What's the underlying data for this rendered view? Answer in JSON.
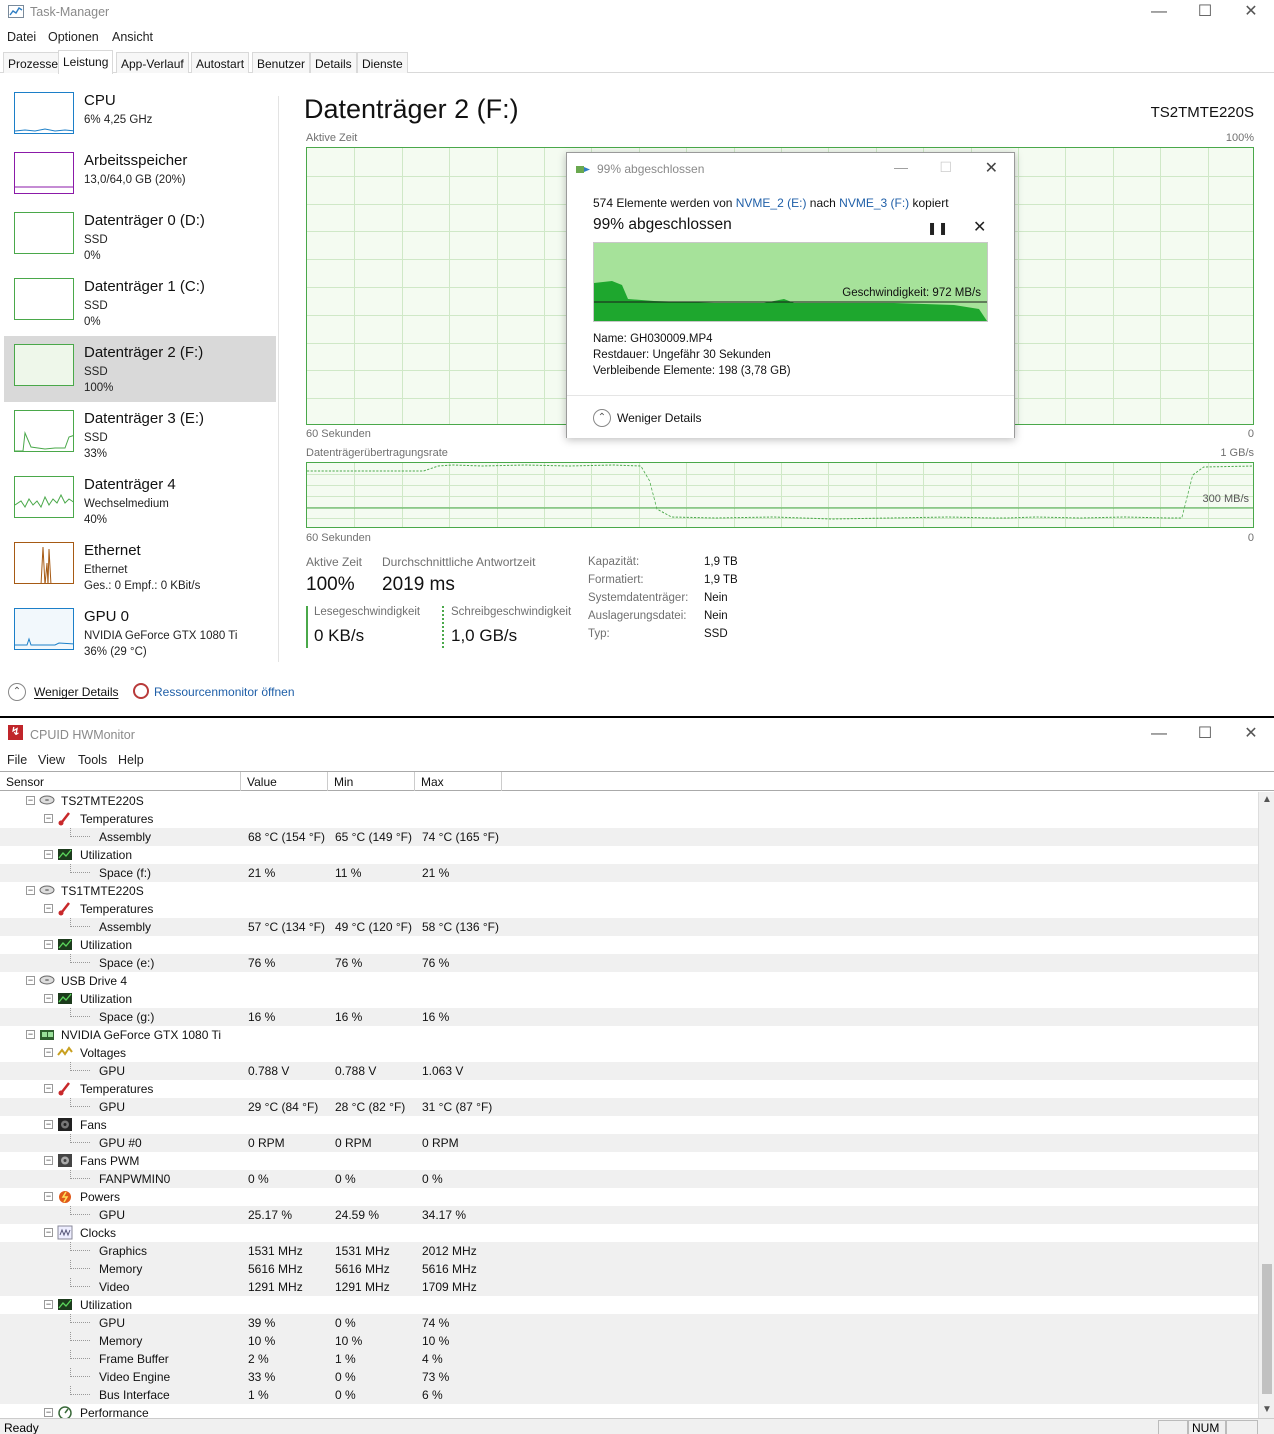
{
  "task_manager": {
    "title": "Task-Manager",
    "menu": [
      "Datei",
      "Optionen",
      "Ansicht"
    ],
    "tabs": [
      "Prozesse",
      "Leistung",
      "App-Verlauf",
      "Autostart",
      "Benutzer",
      "Details",
      "Dienste"
    ],
    "active_tab": "Leistung",
    "sidebar": [
      {
        "name": "CPU",
        "l1": "6% 4,25 GHz",
        "l2": "",
        "color": "#1c7fc8"
      },
      {
        "name": "Arbeitsspeicher",
        "l1": "13,0/64,0 GB (20%)",
        "l2": "",
        "color": "#8b1aa8"
      },
      {
        "name": "Datenträger 0 (D:)",
        "l1": "SSD",
        "l2": "0%",
        "color": "#4aa84a"
      },
      {
        "name": "Datenträger 1 (C:)",
        "l1": "SSD",
        "l2": "0%",
        "color": "#4aa84a"
      },
      {
        "name": "Datenträger 2 (F:)",
        "l1": "SSD",
        "l2": "100%",
        "color": "#4aa84a"
      },
      {
        "name": "Datenträger 3 (E:)",
        "l1": "SSD",
        "l2": "33%",
        "color": "#4aa84a"
      },
      {
        "name": "Datenträger 4",
        "l1": "Wechselmedium",
        "l2": "40%",
        "color": "#4aa84a"
      },
      {
        "name": "Ethernet",
        "l1": "Ethernet",
        "l2": "Ges.: 0 Empf.: 0 KBit/s",
        "color": "#a65a14"
      },
      {
        "name": "GPU 0",
        "l1": "NVIDIA GeForce GTX 1080 Ti",
        "l2": "36% (29 °C)",
        "color": "#1c7fc8"
      }
    ],
    "main": {
      "title": "Datenträger 2 (F:)",
      "model": "TS2TMTE220S",
      "graph1_label": "Aktive Zeit",
      "graph1_max": "100%",
      "graph1_time": "60 Sekunden",
      "graph1_min": "0",
      "graph2_label": "Datenträgerübertragungsrate",
      "graph2_max": "1 GB/s",
      "graph2_mid": "300 MB/s",
      "graph2_time": "60 Sekunden",
      "graph2_min": "0",
      "active_time_label": "Aktive Zeit",
      "active_time": "100%",
      "response_label": "Durchschnittliche Antwortzeit",
      "response": "2019 ms",
      "read_label": "Lesegeschwindigkeit",
      "read": "0 KB/s",
      "write_label": "Schreibgeschwindigkeit",
      "write": "1,0 GB/s",
      "props": [
        {
          "k": "Kapazität:",
          "v": "1,9 TB"
        },
        {
          "k": "Formatiert:",
          "v": "1,9 TB"
        },
        {
          "k": "Systemdatenträger:",
          "v": "Nein"
        },
        {
          "k": "Auslagerungsdatei:",
          "v": "Nein"
        },
        {
          "k": "Typ:",
          "v": "SSD"
        }
      ]
    },
    "footer": {
      "less": "Weniger Details",
      "resmon": "Ressourcenmonitor öffnen"
    }
  },
  "copy_dialog": {
    "title": "99% abgeschlossen",
    "line1_pre": "574 Elemente werden von ",
    "src": "NVME_2 (E:)",
    "line1_mid": " nach ",
    "dst": "NVME_3 (F:)",
    "line1_post": " kopiert",
    "percent": "99% abgeschlossen",
    "progress": 0.99,
    "speed": "Geschwindigkeit: 972 MB/s",
    "name_label": "Name:",
    "name": "GH030009.MP4",
    "remain_label": "Restdauer:",
    "remain": "Ungefähr 30 Sekunden",
    "items_label": "Verbleibende Elemente:",
    "items": "198 (3,78 GB)",
    "less": "Weniger Details"
  },
  "hwmonitor": {
    "title": "CPUID HWMonitor",
    "menu": [
      "File",
      "View",
      "Tools",
      "Help"
    ],
    "columns": [
      "Sensor",
      "Value",
      "Min",
      "Max"
    ],
    "rows": [
      {
        "lvl": 1,
        "name": "TS2TMTE220S",
        "icon": "disk-icon",
        "v": "",
        "mn": "",
        "mx": ""
      },
      {
        "lvl": 2,
        "name": "Temperatures",
        "icon": "thermometer-icon",
        "v": "",
        "mn": "",
        "mx": ""
      },
      {
        "lvl": 3,
        "name": "Assembly",
        "v": "68 °C  (154 °F)",
        "mn": "65 °C  (149 °F)",
        "mx": "74 °C  (165 °F)"
      },
      {
        "lvl": 2,
        "name": "Utilization",
        "icon": "utilization-icon",
        "v": "",
        "mn": "",
        "mx": ""
      },
      {
        "lvl": 3,
        "name": "Space (f:)",
        "v": "21 %",
        "mn": "11 %",
        "mx": "21 %"
      },
      {
        "lvl": 1,
        "name": "TS1TMTE220S",
        "icon": "disk-icon",
        "v": "",
        "mn": "",
        "mx": ""
      },
      {
        "lvl": 2,
        "name": "Temperatures",
        "icon": "thermometer-icon",
        "v": "",
        "mn": "",
        "mx": ""
      },
      {
        "lvl": 3,
        "name": "Assembly",
        "v": "57 °C  (134 °F)",
        "mn": "49 °C  (120 °F)",
        "mx": "58 °C  (136 °F)"
      },
      {
        "lvl": 2,
        "name": "Utilization",
        "icon": "utilization-icon",
        "v": "",
        "mn": "",
        "mx": ""
      },
      {
        "lvl": 3,
        "name": "Space (e:)",
        "v": "76 %",
        "mn": "76 %",
        "mx": "76 %"
      },
      {
        "lvl": 1,
        "name": "USB Drive 4",
        "icon": "disk-icon",
        "v": "",
        "mn": "",
        "mx": ""
      },
      {
        "lvl": 2,
        "name": "Utilization",
        "icon": "utilization-icon",
        "v": "",
        "mn": "",
        "mx": ""
      },
      {
        "lvl": 3,
        "name": "Space (g:)",
        "v": "16 %",
        "mn": "16 %",
        "mx": "16 %"
      },
      {
        "lvl": 1,
        "name": "NVIDIA GeForce GTX 1080 Ti",
        "icon": "gpu-icon",
        "v": "",
        "mn": "",
        "mx": ""
      },
      {
        "lvl": 2,
        "name": "Voltages",
        "icon": "voltage-icon",
        "v": "",
        "mn": "",
        "mx": ""
      },
      {
        "lvl": 3,
        "name": "GPU",
        "v": "0.788 V",
        "mn": "0.788 V",
        "mx": "1.063 V"
      },
      {
        "lvl": 2,
        "name": "Temperatures",
        "icon": "thermometer-icon",
        "v": "",
        "mn": "",
        "mx": ""
      },
      {
        "lvl": 3,
        "name": "GPU",
        "v": "29 °C  (84 °F)",
        "mn": "28 °C  (82 °F)",
        "mx": "31 °C  (87 °F)"
      },
      {
        "lvl": 2,
        "name": "Fans",
        "icon": "fan-icon",
        "v": "",
        "mn": "",
        "mx": ""
      },
      {
        "lvl": 3,
        "name": "GPU #0",
        "v": "0 RPM",
        "mn": "0 RPM",
        "mx": "0 RPM"
      },
      {
        "lvl": 2,
        "name": "Fans PWM",
        "icon": "fan-pwm-icon",
        "v": "",
        "mn": "",
        "mx": ""
      },
      {
        "lvl": 3,
        "name": "FANPWMIN0",
        "v": "0 %",
        "mn": "0 %",
        "mx": "0 %"
      },
      {
        "lvl": 2,
        "name": "Powers",
        "icon": "power-icon",
        "v": "",
        "mn": "",
        "mx": ""
      },
      {
        "lvl": 3,
        "name": "GPU",
        "v": "25.17 %",
        "mn": "24.59 %",
        "mx": "34.17 %"
      },
      {
        "lvl": 2,
        "name": "Clocks",
        "icon": "clock-icon",
        "v": "",
        "mn": "",
        "mx": ""
      },
      {
        "lvl": 3,
        "name": "Graphics",
        "v": "1531 MHz",
        "mn": "1531 MHz",
        "mx": "2012 MHz"
      },
      {
        "lvl": 3,
        "name": "Memory",
        "v": "5616 MHz",
        "mn": "5616 MHz",
        "mx": "5616 MHz"
      },
      {
        "lvl": 3,
        "name": "Video",
        "v": "1291 MHz",
        "mn": "1291 MHz",
        "mx": "1709 MHz"
      },
      {
        "lvl": 2,
        "name": "Utilization",
        "icon": "utilization-icon",
        "v": "",
        "mn": "",
        "mx": ""
      },
      {
        "lvl": 3,
        "name": "GPU",
        "v": "39 %",
        "mn": "0 %",
        "mx": "74 %"
      },
      {
        "lvl": 3,
        "name": "Memory",
        "v": "10 %",
        "mn": "10 %",
        "mx": "10 %"
      },
      {
        "lvl": 3,
        "name": "Frame Buffer",
        "v": "2 %",
        "mn": "1 %",
        "mx": "4 %"
      },
      {
        "lvl": 3,
        "name": "Video Engine",
        "v": "33 %",
        "mn": "0 %",
        "mx": "73 %"
      },
      {
        "lvl": 3,
        "name": "Bus Interface",
        "v": "1 %",
        "mn": "0 %",
        "mx": "6 %"
      },
      {
        "lvl": 2,
        "name": "Performance",
        "icon": "performance-icon",
        "v": "",
        "mn": "",
        "mx": ""
      }
    ],
    "status": "Ready",
    "status_num": "NUM"
  }
}
